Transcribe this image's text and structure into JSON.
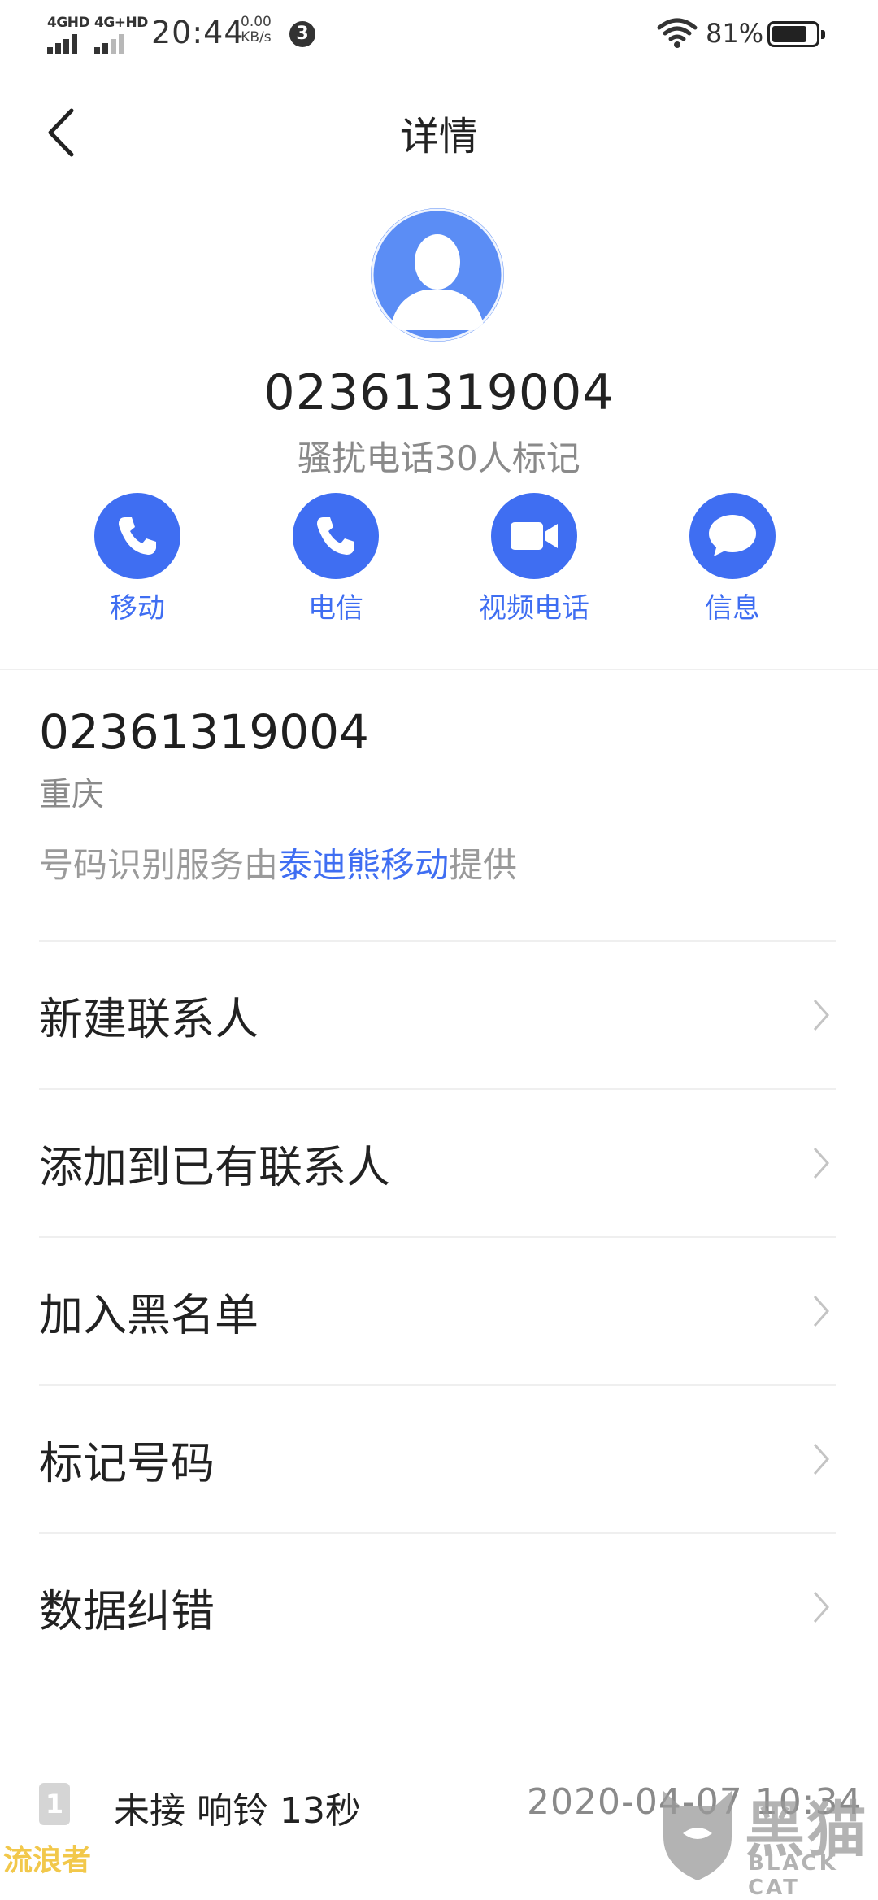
{
  "status_bar": {
    "network_1": "4GHD",
    "network_2": "4G+HD",
    "time": "20:44",
    "speed_value": "0.00",
    "speed_unit": "KB/s",
    "notification_count": "3",
    "battery_percent": "81%",
    "battery_level": 0.81
  },
  "header": {
    "title": "详情"
  },
  "contact": {
    "number": "02361319004",
    "tag": "骚扰电话30人标记"
  },
  "actions": [
    {
      "label": "移动",
      "icon": "phone-icon"
    },
    {
      "label": "电信",
      "icon": "phone-icon"
    },
    {
      "label": "视频电话",
      "icon": "video-icon"
    },
    {
      "label": "信息",
      "icon": "message-icon"
    }
  ],
  "info": {
    "number": "02361319004",
    "location": "重庆",
    "source_prefix": "号码识别服务由",
    "source_link": "泰迪熊移动",
    "source_suffix": "提供"
  },
  "menu": [
    {
      "label": "新建联系人"
    },
    {
      "label": "添加到已有联系人"
    },
    {
      "label": "加入黑名单"
    },
    {
      "label": "标记号码"
    },
    {
      "label": "数据纠错"
    }
  ],
  "call_log": {
    "sim": "1",
    "text": "未接 响铃 13秒",
    "date": "2020-04-07 10:34"
  },
  "watermarks": {
    "left": "流浪者",
    "right_cn": "黑猫",
    "right_en": "BLACK CAT"
  },
  "colors": {
    "accent": "#3f6ef2",
    "avatar": "#5b8df5"
  }
}
